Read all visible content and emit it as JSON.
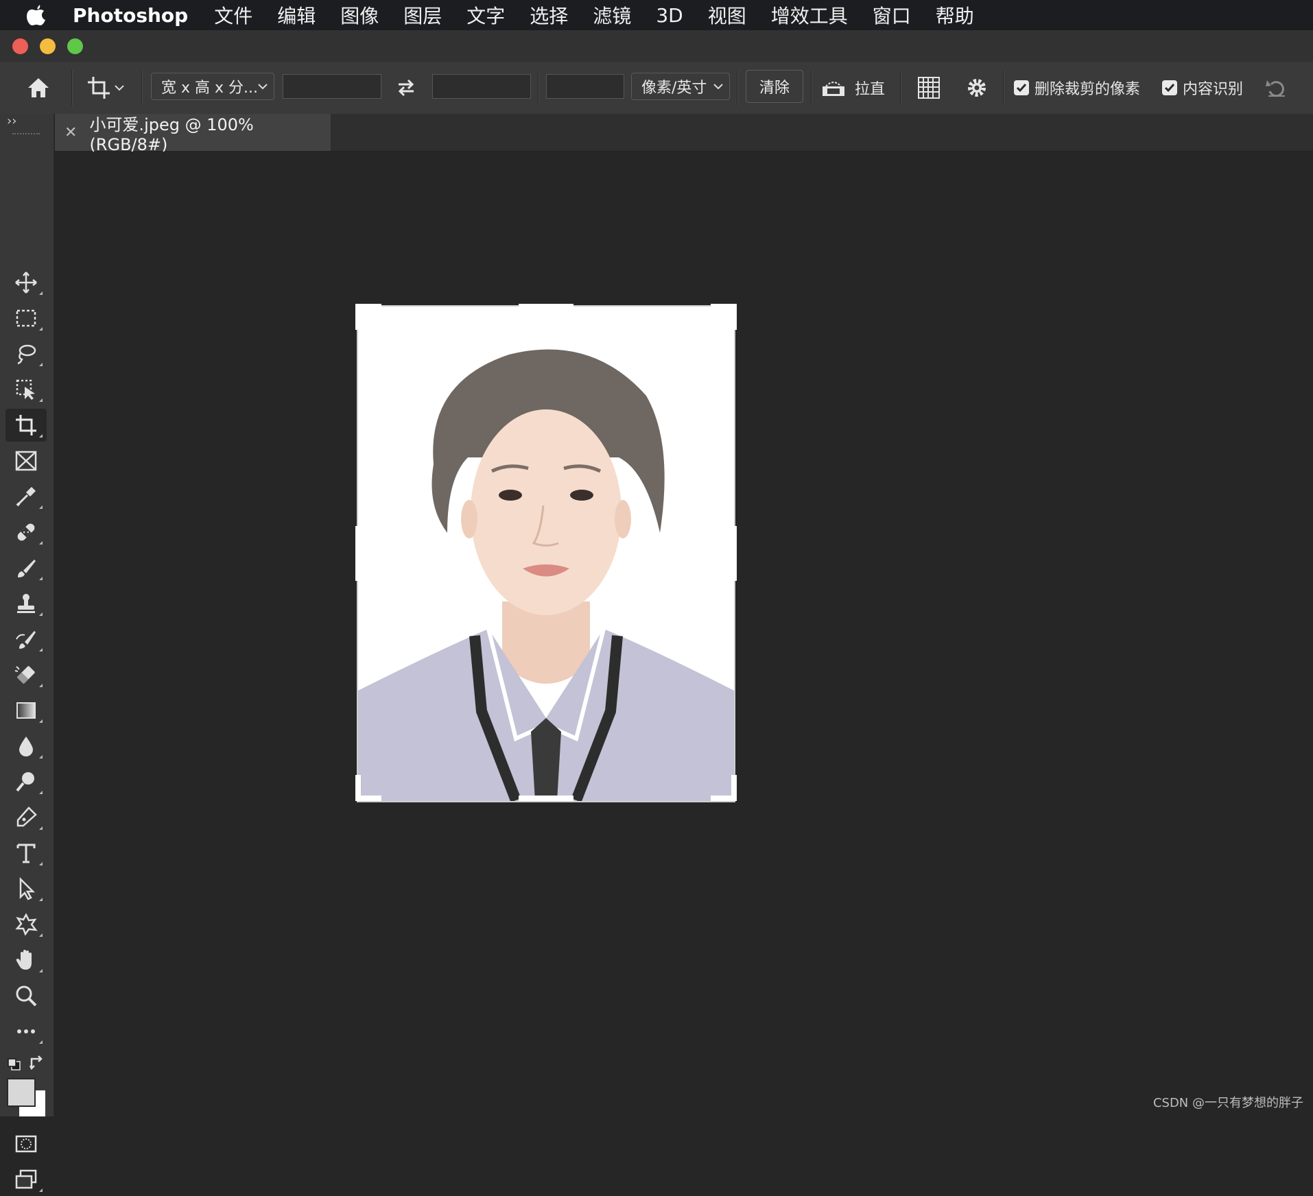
{
  "menubar": {
    "app_name": "Photoshop",
    "items": [
      "文件",
      "编辑",
      "图像",
      "图层",
      "文字",
      "选择",
      "滤镜",
      "3D",
      "视图",
      "增效工具",
      "窗口",
      "帮助"
    ]
  },
  "options": {
    "ratio_dropdown": "宽 x 高 x 分...",
    "unit_dropdown": "像素/英寸",
    "clear_label": "清除",
    "straighten_label": "拉直",
    "delete_cropped_label": "删除裁剪的像素",
    "content_aware_label": "内容识别"
  },
  "document": {
    "tab_title": "小可爱.jpeg @ 100%(RGB/8#)"
  },
  "footer": {
    "watermark": "CSDN @一只有梦想的胖子"
  },
  "colors": {
    "menubar_bg": "#1c1d20",
    "options_bg": "#3a3a3a",
    "canvas_bg": "#262626",
    "shirt": "#c3c2d6"
  }
}
